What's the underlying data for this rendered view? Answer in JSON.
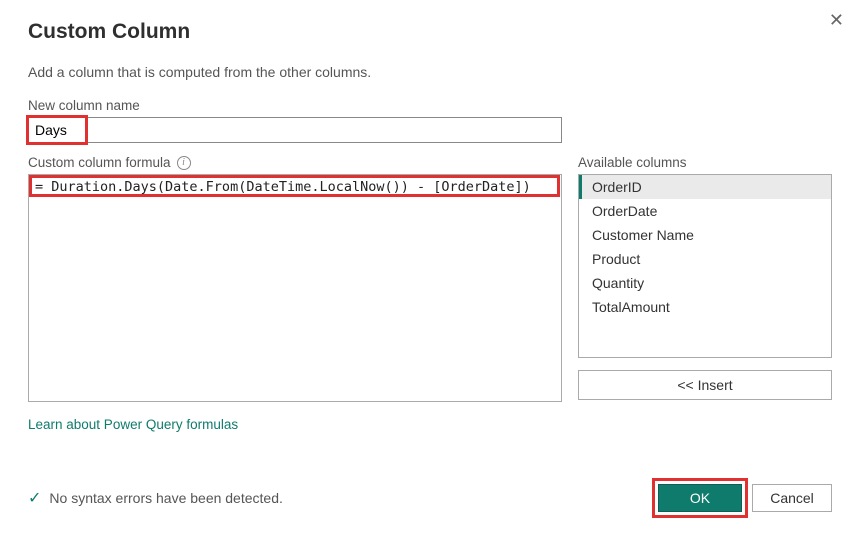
{
  "dialog": {
    "title": "Custom Column",
    "subtitle": "Add a column that is computed from the other columns.",
    "close_label": "✕"
  },
  "new_column": {
    "label": "New column name",
    "value": "Days"
  },
  "formula": {
    "label": "Custom column formula",
    "value": "= Duration.Days(Date.From(DateTime.LocalNow()) - [OrderDate])"
  },
  "available": {
    "label": "Available columns",
    "items": [
      {
        "label": "OrderID",
        "selected": true
      },
      {
        "label": "OrderDate",
        "selected": false
      },
      {
        "label": "Customer Name",
        "selected": false
      },
      {
        "label": "Product",
        "selected": false
      },
      {
        "label": "Quantity",
        "selected": false
      },
      {
        "label": "TotalAmount",
        "selected": false
      }
    ],
    "insert_label": "<< Insert"
  },
  "learn_link": "Learn about Power Query formulas",
  "status": {
    "text": "No syntax errors have been detected."
  },
  "buttons": {
    "ok": "OK",
    "cancel": "Cancel"
  }
}
